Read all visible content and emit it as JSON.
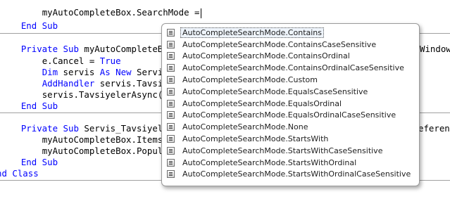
{
  "code": {
    "l1": {
      "indent": "        ",
      "text": "myAutoCompleteBox.SearchMode ="
    },
    "l2": {
      "indent": "    ",
      "kw": "End Sub"
    },
    "l3": {
      "indent": "    ",
      "kw": "Private Sub",
      "text": " myAutoCompleteBox_",
      "tail": "Window"
    },
    "l4": {
      "indent": "        ",
      "text": "e.Cancel = ",
      "kw": "True"
    },
    "l5": {
      "indent": "        ",
      "kw1": "Dim",
      "t1": " servis ",
      "kw2": "As New",
      "t2": " ServiceR"
    },
    "l6": {
      "indent": "        ",
      "kw": "AddHandler",
      "text": " servis.Tavsiyel"
    },
    "l7": {
      "indent": "        ",
      "text": "servis.TavsiyelerAsync(myA"
    },
    "l8": {
      "indent": "    ",
      "kw": "End Sub"
    },
    "l9": {
      "indent": "    ",
      "kw": "Private Sub",
      "text": " Servis_TavsiyelerC",
      "tail": "eferenc"
    },
    "l10": {
      "indent": "        ",
      "text": "myAutoCompleteBox.ItemsSou"
    },
    "l11": {
      "indent": "        ",
      "text": "myAutoCompleteBox.Populate"
    },
    "l12": {
      "indent": "    ",
      "kw": "End Sub"
    },
    "l13": {
      "kw": "nd Class"
    }
  },
  "autocomplete": {
    "icon": "enum-member-icon",
    "items": [
      "AutoCompleteSearchMode.Contains",
      "AutoCompleteSearchMode.ContainsCaseSensitive",
      "AutoCompleteSearchMode.ContainsOrdinal",
      "AutoCompleteSearchMode.ContainsOrdinalCaseSensitive",
      "AutoCompleteSearchMode.Custom",
      "AutoCompleteSearchMode.EqualsCaseSensitive",
      "AutoCompleteSearchMode.EqualsOrdinal",
      "AutoCompleteSearchMode.EqualsOrdinalCaseSensitive",
      "AutoCompleteSearchMode.None",
      "AutoCompleteSearchMode.StartsWith",
      "AutoCompleteSearchMode.StartsWithCaseSensitive",
      "AutoCompleteSearchMode.StartsWithOrdinal",
      "AutoCompleteSearchMode.StartsWithOrdinalCaseSensitive"
    ],
    "selected_index": 0
  },
  "colors": {
    "keyword": "#0000ff",
    "text": "#000000",
    "separator": "#a0a0a0"
  }
}
